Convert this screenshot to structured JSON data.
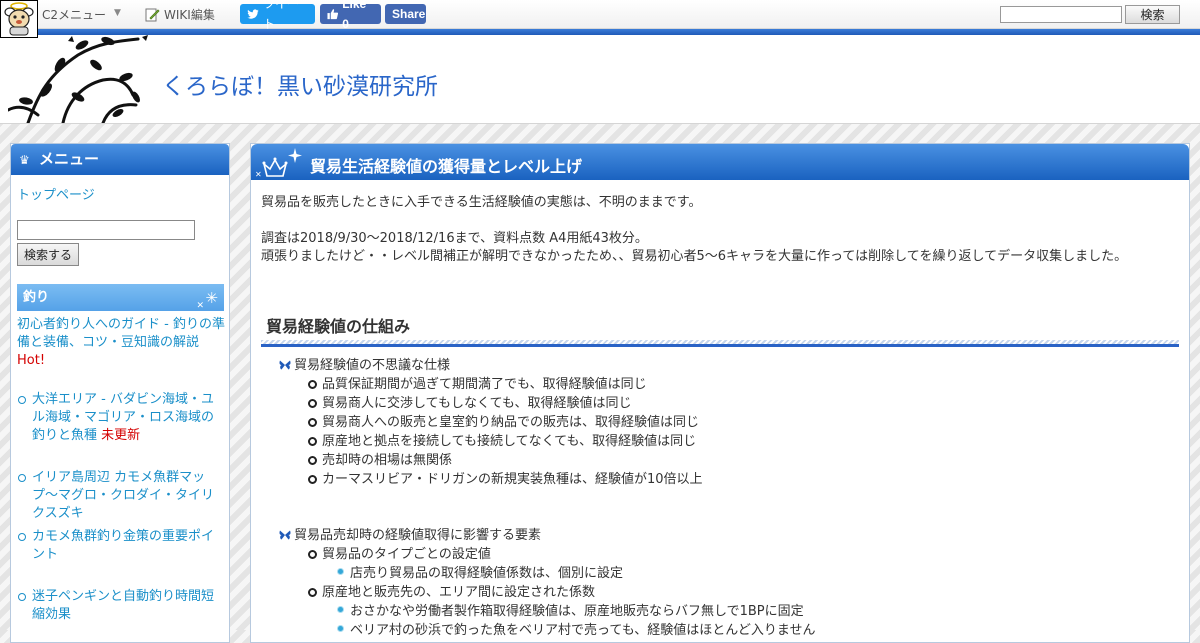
{
  "toolbar": {
    "menu_label": "C2メニュー",
    "wiki_edit_label": "WIKI編集",
    "tweet_label": "ツイート",
    "like_label": "Like 0",
    "share_label": "Share",
    "search_button": "検索",
    "search_value": ""
  },
  "header": {
    "site_title": "くろらぼ！黒い砂漠研究所"
  },
  "sidebar": {
    "menu_title": "メニュー",
    "top_page": "トップページ",
    "search_value": "",
    "search_button": "検索する",
    "fishing_title": "釣り",
    "feature": {
      "text": "初心者釣り人へのガイド - 釣りの準備と装備、コツ・豆知識の解説",
      "badge": "Hot!"
    },
    "items": [
      {
        "text": "大洋エリア - バダビン海域・ユル海域・マゴリア・ロス海域の釣りと魚種",
        "badge": "未更新"
      },
      {
        "text": "イリア島周辺 カモメ魚群マップ～マグロ・クロダイ・タイリクスズキ",
        "badge": ""
      },
      {
        "text": "カモメ魚群釣り金策の重要ポイント",
        "badge": ""
      },
      {
        "text": "迷子ペンギンと自動釣り時間短縮効果",
        "badge": ""
      }
    ]
  },
  "main": {
    "title": "貿易生活経験値の獲得量とレベル上げ",
    "intro": "貿易品を販売したときに入手できる生活経験値の実態は、不明のままです。",
    "survey_line1": "調査は2018/9/30～2018/12/16まで、資料点数 A4用紙43枚分。",
    "survey_line2": "頑張りましたけど・・レベル間補正が解明できなかったため、、貿易初心者5～6キャラを大量に作っては削除してを繰り返してデータ収集しました。",
    "section_title": "貿易経験値の仕組み",
    "group1": {
      "title": "貿易経験値の不思議な仕様",
      "items": [
        "品質保証期間が過ぎて期間満了でも、取得経験値は同じ",
        "貿易商人に交渉してもしなくても、取得経験値は同じ",
        "貿易商人への販売と皇室釣り納品での販売は、取得経験値は同じ",
        "原産地と拠点を接続しても接続してなくても、取得経験値は同じ",
        "売却時の相場は無関係",
        "カーマスリビア・ドリガンの新規実装魚種は、経験値が10倍以上"
      ]
    },
    "group2": {
      "title": "貿易品売却時の経験値取得に影響する要素",
      "sub1": {
        "title": "貿易品のタイプごとの設定値",
        "items": [
          "店売り貿易品の取得経験値係数は、個別に設定"
        ]
      },
      "sub2": {
        "title": "原産地と販売先の、エリア間に設定された係数",
        "items": [
          "おさかなや労働者製作箱取得経験値は、原産地販売ならバフ無しで1BPに固定",
          "ベリア村の砂浜で釣った魚をベリア村で売っても、経験値はほとんど入りません"
        ]
      }
    }
  }
}
